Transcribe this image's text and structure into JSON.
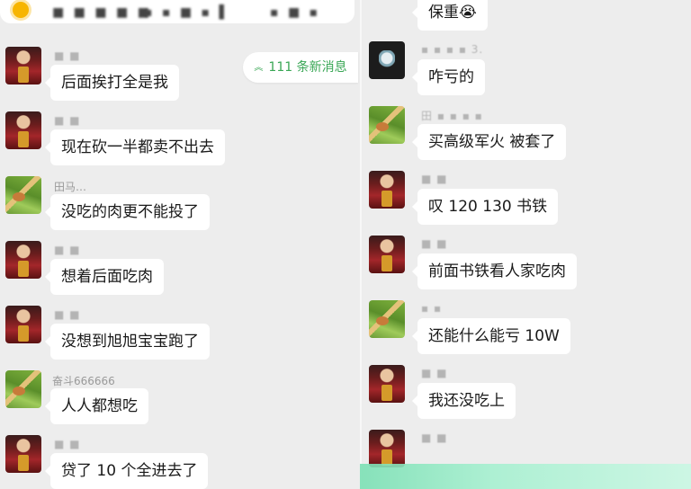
{
  "left_pane": {
    "top_bar": {
      "blurred_text_a": "■ ■ ■ ■ ■",
      "blurred_text_b": "▪ ▪ ■ ▪ ▌",
      "blurred_text_c": "▪ ■ ▪"
    },
    "new_messages": {
      "label": "111 条新消息",
      "icon": "chevron-up-icon"
    },
    "messages": [
      {
        "nick": "■ ■",
        "text": "后面挨打全是我",
        "avatar": "red"
      },
      {
        "nick": "■ ■",
        "text": "现在砍一半都卖不出去",
        "avatar": "red"
      },
      {
        "nick": "田马…",
        "text": "没吃的肉更不能投了",
        "avatar": "green"
      },
      {
        "nick": "■ ■",
        "text": "想着后面吃肉",
        "avatar": "red"
      },
      {
        "nick": "■ ■",
        "text": "没想到旭旭宝宝跑了",
        "avatar": "red"
      },
      {
        "nick": "奋斗666666",
        "text": "人人都想吃",
        "avatar": "green"
      },
      {
        "nick": "■ ■",
        "text": "贷了 10 个全进去了",
        "avatar": "red"
      }
    ]
  },
  "right_pane": {
    "messages": [
      {
        "nick": "",
        "text": "保重😭",
        "avatar": "none"
      },
      {
        "nick": "▪ ▪ ▪ ▪   3.",
        "text": "咋亏的",
        "avatar": "dark"
      },
      {
        "nick": "田 ▪ ▪ ▪ ▪",
        "text": "买高级军火 被套了",
        "avatar": "green"
      },
      {
        "nick": "■ ■",
        "text": "叹 120 130 书铁",
        "avatar": "red"
      },
      {
        "nick": "■ ■",
        "text": "前面书铁看人家吃肉",
        "avatar": "red"
      },
      {
        "nick": "▪ ▪",
        "text": "还能什么能亏 10W",
        "avatar": "green"
      },
      {
        "nick": "■ ■",
        "text": "我还没吃上",
        "avatar": "red"
      },
      {
        "nick": "■ ■",
        "text": "",
        "avatar": "red"
      }
    ]
  },
  "colors": {
    "background": "#ededed",
    "bubble": "#ffffff",
    "accent_green": "#3aa756"
  }
}
